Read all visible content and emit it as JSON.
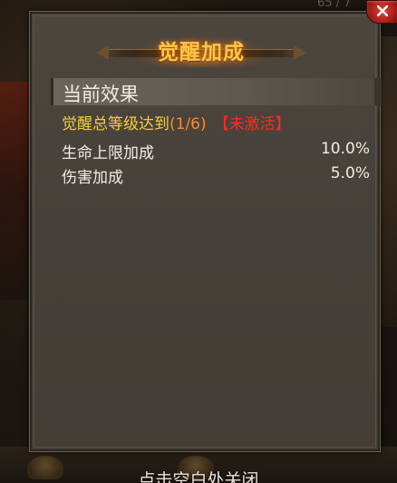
{
  "background": {
    "top_text": "65 / 7"
  },
  "dialog": {
    "title": "觉醒加成",
    "close_icon": "close-x-icon",
    "section_header": "当前效果",
    "condition": {
      "main": "觉醒总等级达到",
      "progress": "(1/6)",
      "status": "【未激活】"
    },
    "stats": [
      {
        "label": "生命上限加成",
        "value": "10.0%"
      },
      {
        "label": "伤害加成",
        "value": "5.0%"
      }
    ]
  },
  "footer": {
    "hint": "点击空白处关闭"
  },
  "colors": {
    "title": "#ffc44a",
    "condition": "#f5cf3a",
    "progress": "#ff8a2a",
    "status_inactive": "#ff2b1e",
    "text": "#f0ece4"
  }
}
